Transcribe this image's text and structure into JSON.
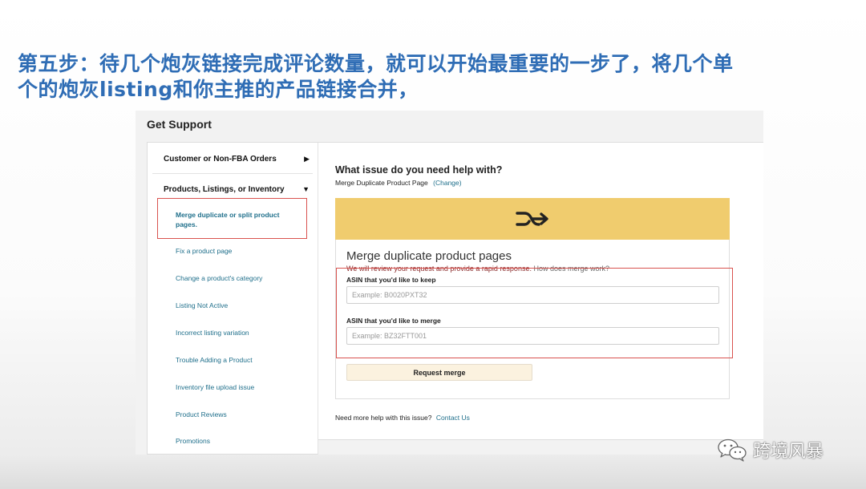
{
  "slide": {
    "title_line1": "第五步：待几个炮灰链接完成评论数量，就可以开始最重要的一步了，将几个单",
    "title_line2": "个的炮灰listing和你主推的产品链接合并，"
  },
  "support": {
    "title": "Get Support",
    "sidebar": {
      "category1": {
        "label": "Customer or Non-FBA Orders",
        "arrow": "▶"
      },
      "category2": {
        "label": "Products, Listings, or Inventory",
        "arrow": "▼"
      },
      "selected_item": "Merge duplicate or split product pages.",
      "items": [
        "Fix a product page",
        "Change a product's category",
        "Listing Not Active",
        "Incorrect listing variation",
        "Trouble Adding a Product",
        "Inventory file upload issue",
        "Product Reviews",
        "Promotions"
      ]
    },
    "main": {
      "question": "What issue do you need help with?",
      "current_issue": "Merge Duplicate Product Page",
      "change_link": "(Change)",
      "card": {
        "title": "Merge duplicate product pages",
        "note": "We will review your request and provide a rapid response.",
        "how_link": "How does merge work?",
        "keep_label": "ASIN that you'd like to keep",
        "keep_placeholder": "Example: B0020PXT32",
        "merge_label": "ASIN that you'd like to merge",
        "merge_placeholder": "Example: BZ32FTT001",
        "button": "Request merge"
      },
      "help_text": "Need more help with this issue?",
      "contact_link": "Contact Us"
    }
  },
  "watermark": {
    "text": "跨境风暴",
    "icon": "wechat-icon"
  },
  "colors": {
    "title": "#2f6db5",
    "banner": "#f0cc6e",
    "link": "#1f6f8b",
    "highlight": "#d9534f"
  }
}
